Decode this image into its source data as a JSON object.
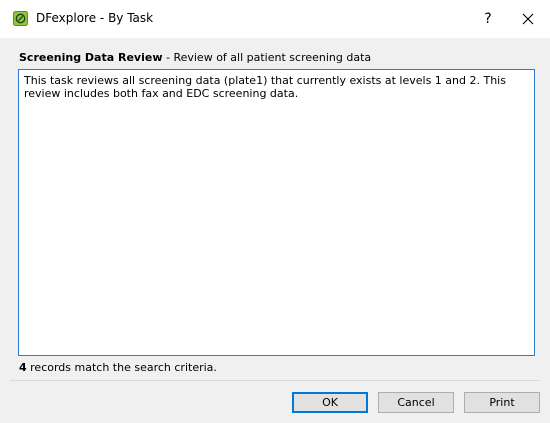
{
  "window": {
    "title": "DFexplore - By Task",
    "help_label": "?",
    "icon": "dfexplore-app-icon",
    "close_icon": "close-icon"
  },
  "task": {
    "name": "Screening Data Review",
    "separator": " - ",
    "summary": "Review of all patient screening data",
    "description": "This task reviews all screening data (plate1) that currently exists at levels 1 and 2. This review includes both fax and EDC screening data."
  },
  "status": {
    "count": "4",
    "text": " records match the search criteria."
  },
  "buttons": {
    "ok": "OK",
    "cancel": "Cancel",
    "print": "Print"
  },
  "colors": {
    "focus_border": "#2e7bd6",
    "icon_green": "#8cc63f",
    "dialog_bg": "#f0f0f0"
  }
}
